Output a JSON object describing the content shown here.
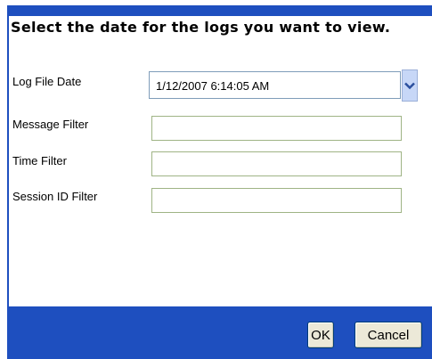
{
  "dialog": {
    "heading": "Select the date for the logs you want to view."
  },
  "form": {
    "log_file_date_label": "Log File Date",
    "log_file_date_value": "1/12/2007 6:14:05 AM",
    "message_filter_label": "Message Filter",
    "message_filter_value": "",
    "time_filter_label": "Time Filter",
    "time_filter_value": "",
    "session_id_filter_label": "Session ID Filter",
    "session_id_filter_value": ""
  },
  "buttons": {
    "ok_label": "OK",
    "cancel_label": "Cancel"
  },
  "colors": {
    "dialog_background": "#1e4fbf",
    "panel_background": "#ffffff",
    "field_border": "#9fb485"
  },
  "icons": {
    "dropdown": "chevron-down-icon"
  }
}
